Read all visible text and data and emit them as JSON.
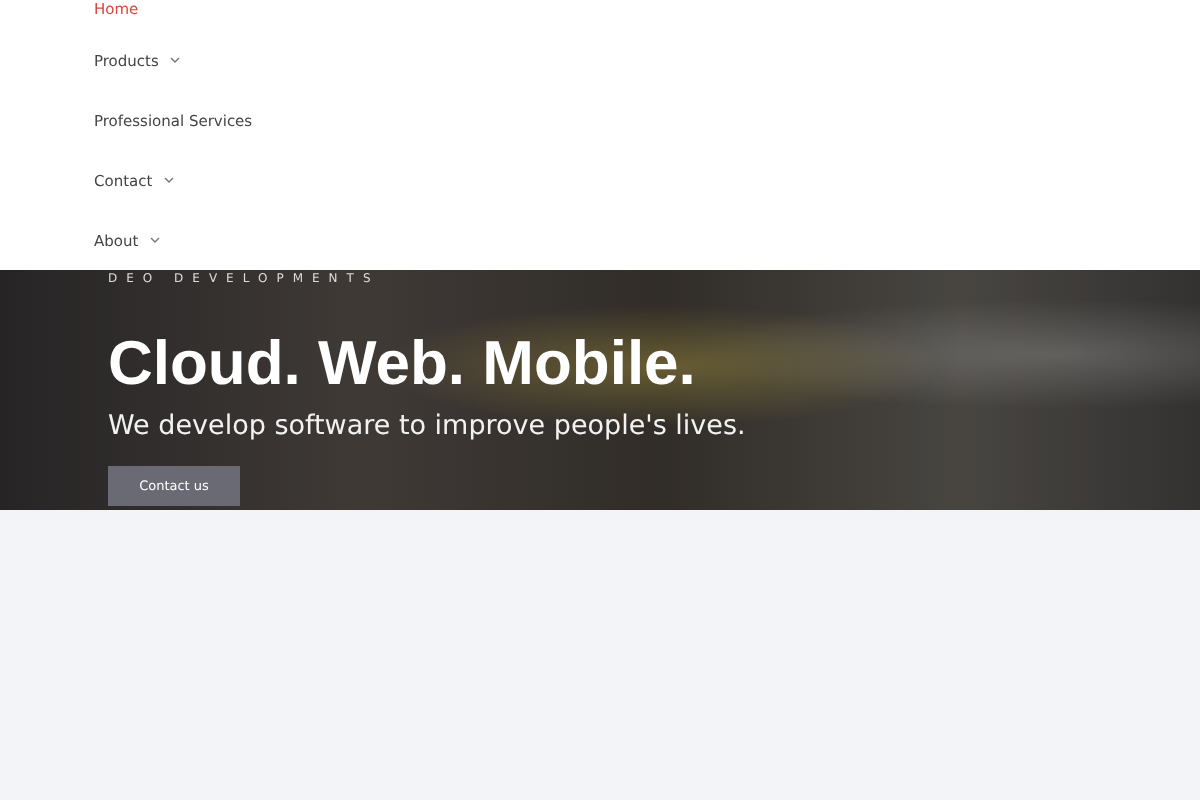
{
  "menu": {
    "items": [
      {
        "label": "Home",
        "selected": true,
        "has_submenu": false
      },
      {
        "label": "Products",
        "selected": false,
        "has_submenu": true
      },
      {
        "label": "Professional Services",
        "selected": false,
        "has_submenu": false
      },
      {
        "label": "Contact",
        "selected": false,
        "has_submenu": true
      },
      {
        "label": "About",
        "selected": false,
        "has_submenu": true
      }
    ]
  },
  "hero": {
    "eyebrow": "DEO DEVELOPMENTS",
    "title": "Cloud. Web. Mobile.",
    "subtitle": "We develop software to improve people's lives.",
    "button": "Contact us"
  }
}
